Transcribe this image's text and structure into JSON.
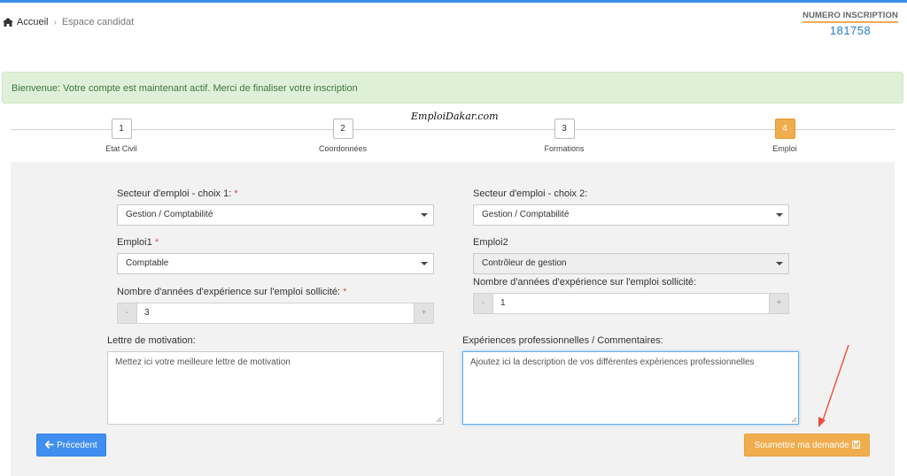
{
  "breadcrumb": {
    "home": "Accueil",
    "current": "Espace candidat"
  },
  "inscription": {
    "label": "NUMERO INSCRIPTION",
    "number": "181758"
  },
  "alert": {
    "text": "Bienvenue: Votre compte est maintenant actif. Merci de finaliser votre inscription"
  },
  "brand": "EmploiDakar.com",
  "steps": [
    {
      "num": "1",
      "label": "Etat Civil"
    },
    {
      "num": "2",
      "label": "Coordonnées"
    },
    {
      "num": "3",
      "label": "Formations"
    },
    {
      "num": "4",
      "label": "Emploi",
      "active": true
    }
  ],
  "form": {
    "secteur1": {
      "label": "Secteur d'emploi - choix 1:",
      "required": "*",
      "value": "Gestion / Comptabilité"
    },
    "secteur2": {
      "label": "Secteur d'emploi - choix 2:",
      "value": "Gestion / Comptabilité"
    },
    "emploi1": {
      "label": "Emploi1",
      "required": "*",
      "value": "Comptable"
    },
    "emploi2": {
      "label": "Emploi2",
      "value": "Contrôleur de gestion"
    },
    "experience1": {
      "label": "Nombre d'années d'expérience sur l'emploi sollicité:",
      "required": "*",
      "value": "3",
      "minus": "-",
      "plus": "+"
    },
    "experience2": {
      "label": "Nombre d'années d'expérience sur l'emploi sollicité:",
      "value": "1",
      "minus": "-",
      "plus": "+"
    },
    "motivation": {
      "label": "Lettre de motivation:",
      "placeholder": "Mettez ici votre meilleure lettre de motivation"
    },
    "experiences": {
      "label": "Expériences professionnelles / Commentaires:",
      "placeholder": "Ajoutez ici la description de vos différentes expériences professionnelles"
    }
  },
  "buttons": {
    "previous": "Précedent",
    "submit": "Soumettre ma demande"
  },
  "colors": {
    "accent": "#f0ad4e",
    "primary": "#3f8ef0",
    "arrow": "#e8503a"
  }
}
